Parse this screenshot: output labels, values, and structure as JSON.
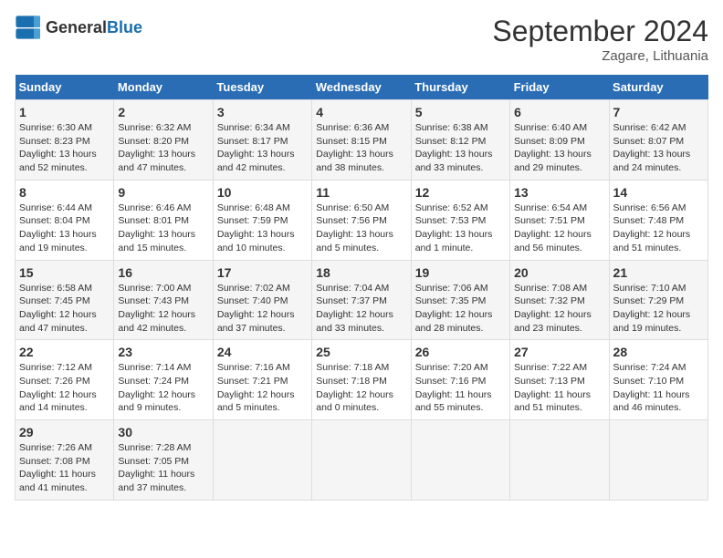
{
  "header": {
    "logo_general": "General",
    "logo_blue": "Blue",
    "month_title": "September 2024",
    "location": "Zagare, Lithuania"
  },
  "days_of_week": [
    "Sunday",
    "Monday",
    "Tuesday",
    "Wednesday",
    "Thursday",
    "Friday",
    "Saturday"
  ],
  "weeks": [
    [
      {
        "day": "1",
        "info": "Sunrise: 6:30 AM\nSunset: 8:23 PM\nDaylight: 13 hours and 52 minutes."
      },
      {
        "day": "2",
        "info": "Sunrise: 6:32 AM\nSunset: 8:20 PM\nDaylight: 13 hours and 47 minutes."
      },
      {
        "day": "3",
        "info": "Sunrise: 6:34 AM\nSunset: 8:17 PM\nDaylight: 13 hours and 42 minutes."
      },
      {
        "day": "4",
        "info": "Sunrise: 6:36 AM\nSunset: 8:15 PM\nDaylight: 13 hours and 38 minutes."
      },
      {
        "day": "5",
        "info": "Sunrise: 6:38 AM\nSunset: 8:12 PM\nDaylight: 13 hours and 33 minutes."
      },
      {
        "day": "6",
        "info": "Sunrise: 6:40 AM\nSunset: 8:09 PM\nDaylight: 13 hours and 29 minutes."
      },
      {
        "day": "7",
        "info": "Sunrise: 6:42 AM\nSunset: 8:07 PM\nDaylight: 13 hours and 24 minutes."
      }
    ],
    [
      {
        "day": "8",
        "info": "Sunrise: 6:44 AM\nSunset: 8:04 PM\nDaylight: 13 hours and 19 minutes."
      },
      {
        "day": "9",
        "info": "Sunrise: 6:46 AM\nSunset: 8:01 PM\nDaylight: 13 hours and 15 minutes."
      },
      {
        "day": "10",
        "info": "Sunrise: 6:48 AM\nSunset: 7:59 PM\nDaylight: 13 hours and 10 minutes."
      },
      {
        "day": "11",
        "info": "Sunrise: 6:50 AM\nSunset: 7:56 PM\nDaylight: 13 hours and 5 minutes."
      },
      {
        "day": "12",
        "info": "Sunrise: 6:52 AM\nSunset: 7:53 PM\nDaylight: 13 hours and 1 minute."
      },
      {
        "day": "13",
        "info": "Sunrise: 6:54 AM\nSunset: 7:51 PM\nDaylight: 12 hours and 56 minutes."
      },
      {
        "day": "14",
        "info": "Sunrise: 6:56 AM\nSunset: 7:48 PM\nDaylight: 12 hours and 51 minutes."
      }
    ],
    [
      {
        "day": "15",
        "info": "Sunrise: 6:58 AM\nSunset: 7:45 PM\nDaylight: 12 hours and 47 minutes."
      },
      {
        "day": "16",
        "info": "Sunrise: 7:00 AM\nSunset: 7:43 PM\nDaylight: 12 hours and 42 minutes."
      },
      {
        "day": "17",
        "info": "Sunrise: 7:02 AM\nSunset: 7:40 PM\nDaylight: 12 hours and 37 minutes."
      },
      {
        "day": "18",
        "info": "Sunrise: 7:04 AM\nSunset: 7:37 PM\nDaylight: 12 hours and 33 minutes."
      },
      {
        "day": "19",
        "info": "Sunrise: 7:06 AM\nSunset: 7:35 PM\nDaylight: 12 hours and 28 minutes."
      },
      {
        "day": "20",
        "info": "Sunrise: 7:08 AM\nSunset: 7:32 PM\nDaylight: 12 hours and 23 minutes."
      },
      {
        "day": "21",
        "info": "Sunrise: 7:10 AM\nSunset: 7:29 PM\nDaylight: 12 hours and 19 minutes."
      }
    ],
    [
      {
        "day": "22",
        "info": "Sunrise: 7:12 AM\nSunset: 7:26 PM\nDaylight: 12 hours and 14 minutes."
      },
      {
        "day": "23",
        "info": "Sunrise: 7:14 AM\nSunset: 7:24 PM\nDaylight: 12 hours and 9 minutes."
      },
      {
        "day": "24",
        "info": "Sunrise: 7:16 AM\nSunset: 7:21 PM\nDaylight: 12 hours and 5 minutes."
      },
      {
        "day": "25",
        "info": "Sunrise: 7:18 AM\nSunset: 7:18 PM\nDaylight: 12 hours and 0 minutes."
      },
      {
        "day": "26",
        "info": "Sunrise: 7:20 AM\nSunset: 7:16 PM\nDaylight: 11 hours and 55 minutes."
      },
      {
        "day": "27",
        "info": "Sunrise: 7:22 AM\nSunset: 7:13 PM\nDaylight: 11 hours and 51 minutes."
      },
      {
        "day": "28",
        "info": "Sunrise: 7:24 AM\nSunset: 7:10 PM\nDaylight: 11 hours and 46 minutes."
      }
    ],
    [
      {
        "day": "29",
        "info": "Sunrise: 7:26 AM\nSunset: 7:08 PM\nDaylight: 11 hours and 41 minutes."
      },
      {
        "day": "30",
        "info": "Sunrise: 7:28 AM\nSunset: 7:05 PM\nDaylight: 11 hours and 37 minutes."
      },
      {
        "day": "",
        "info": ""
      },
      {
        "day": "",
        "info": ""
      },
      {
        "day": "",
        "info": ""
      },
      {
        "day": "",
        "info": ""
      },
      {
        "day": "",
        "info": ""
      }
    ]
  ]
}
